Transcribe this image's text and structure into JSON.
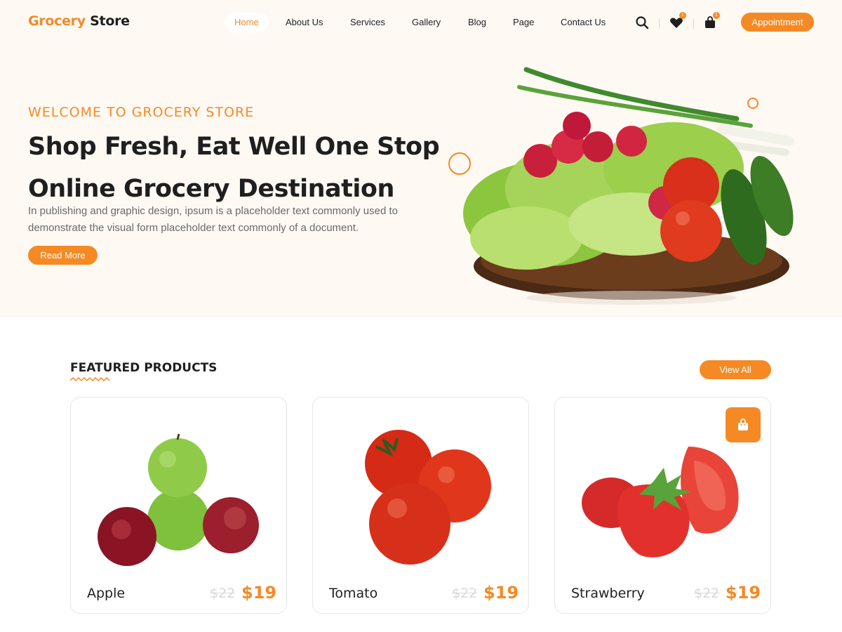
{
  "brand": {
    "part1": "Grocery",
    "part2": "Store"
  },
  "nav": {
    "items": [
      "Home",
      "About Us",
      "Services",
      "Gallery",
      "Blog",
      "Page",
      "Contact Us"
    ],
    "active": "Home"
  },
  "header_icons": {
    "search": "search-icon",
    "wishlist": "heart-icon",
    "wishlist_count": "1",
    "cart": "shopping-bag-icon",
    "cart_count": "1"
  },
  "header": {
    "appointment_label": "Appointment"
  },
  "hero": {
    "kicker": "WELCOME TO GROCERY STORE",
    "title_line1": "Shop Fresh, Eat Well One Stop",
    "title_line2": "Online Grocery Destination",
    "text": "In publishing and graphic design, ipsum is a placeholder text commonly used to demonstrate the visual form placeholder text commonly of a document.",
    "button_label": "Read More"
  },
  "featured": {
    "title": "FEATURED PRODUCTS",
    "view_all_label": "View All",
    "products": [
      {
        "name": "Apple",
        "old_price": "$22",
        "price": "$19"
      },
      {
        "name": "Tomato",
        "old_price": "$22",
        "price": "$19"
      },
      {
        "name": "Strawberry",
        "old_price": "$22",
        "price": "$19"
      }
    ]
  },
  "colors": {
    "accent": "#f58a25",
    "hero_bg": "#fff9f4",
    "text_dark": "#1f1f1f",
    "text_muted": "#6a6a6a"
  }
}
